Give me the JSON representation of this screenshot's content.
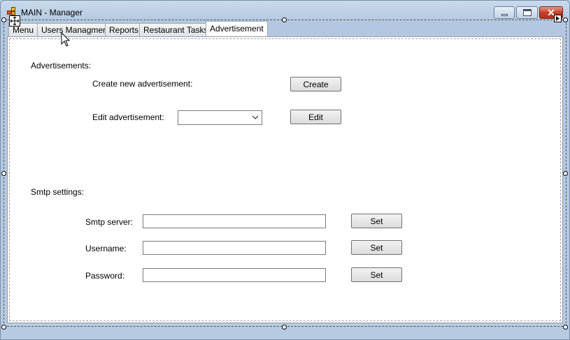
{
  "window": {
    "title": "MAIN - Manager",
    "close_glyph": "✕"
  },
  "tabs": [
    {
      "label": "Menu",
      "active": false
    },
    {
      "label": "Users Managment",
      "active": false
    },
    {
      "label": "Reports",
      "active": false
    },
    {
      "label": "Restaurant Tasks",
      "active": false
    },
    {
      "label": "Advertisement",
      "active": true
    }
  ],
  "advertisements": {
    "section_label": "Advertisements:",
    "create_label": "Create new advertisement:",
    "create_button": "Create",
    "edit_label": "Edit advertisement:",
    "edit_select_value": "",
    "edit_button": "Edit"
  },
  "smtp": {
    "section_label": "Smtp settings:",
    "server_label": "Smtp server:",
    "server_value": "",
    "server_button": "Set",
    "username_label": "Username:",
    "username_value": "",
    "username_button": "Set",
    "password_label": "Password:",
    "password_value": "",
    "password_button": "Set"
  },
  "colors": {
    "window_frame": "#b6cbe2",
    "close_button": "#c7402b",
    "panel_background": "#ffffff"
  },
  "icons": [
    "app-icon",
    "minimize-icon",
    "maximize-icon",
    "close-icon",
    "move-icon",
    "mouse-cursor-icon",
    "chevron-down-icon"
  ]
}
